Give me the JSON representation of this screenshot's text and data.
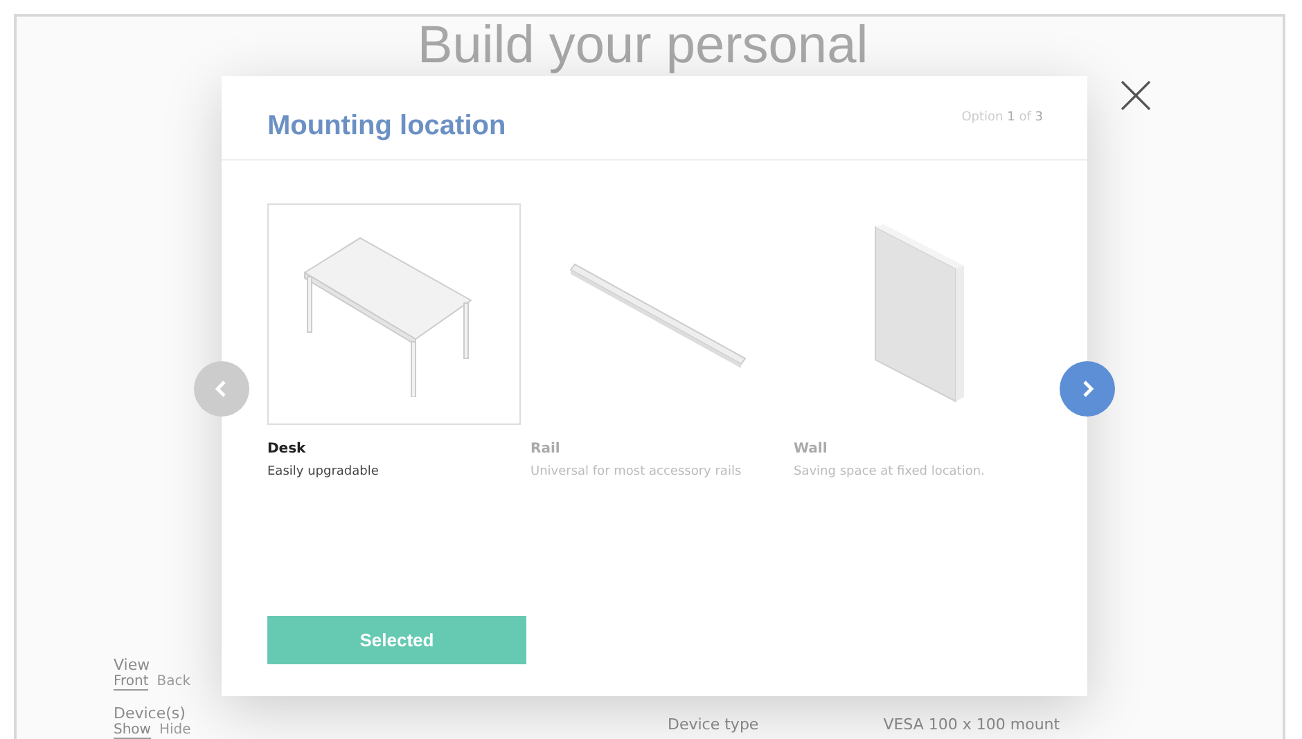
{
  "page": {
    "heading": "Build your personal",
    "view": {
      "label": "View",
      "options": [
        {
          "label": "Front",
          "selected": true
        },
        {
          "label": "Back",
          "selected": false
        }
      ]
    },
    "devices": {
      "label": "Device(s)",
      "options": [
        {
          "label": "Show",
          "selected": true
        },
        {
          "label": "Hide",
          "selected": false
        }
      ]
    },
    "device_type": {
      "label": "Device type",
      "value": "VESA 100 x 100 mount"
    }
  },
  "modal": {
    "title": "Mounting location",
    "counter": "Option **1** of **3**",
    "options": [
      {
        "kind": "desk",
        "name": "Desk",
        "description": "Easily upgradable",
        "selected": true
      },
      {
        "kind": "rail",
        "name": "Rail",
        "description": "Universal for most accessory rails",
        "selected": false
      },
      {
        "kind": "wall",
        "name": "Wall",
        "description": "Saving space at fixed location.",
        "selected": false
      }
    ],
    "prev_enabled": false,
    "next_enabled": true,
    "button": "Selected"
  }
}
